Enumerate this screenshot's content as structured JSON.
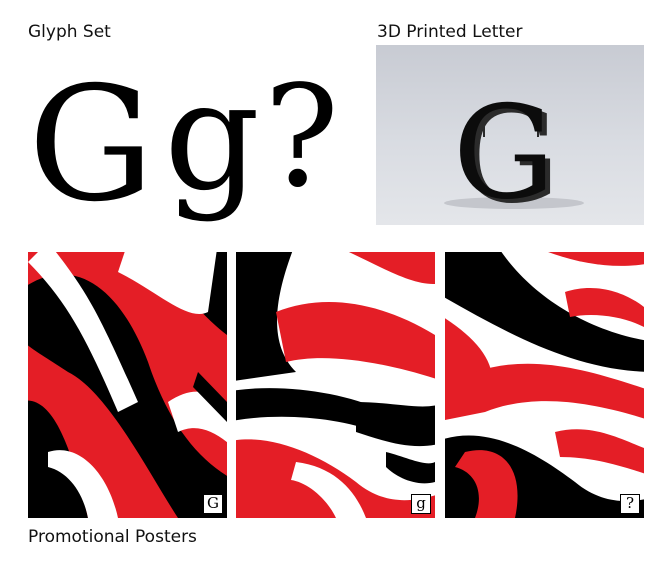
{
  "sections": {
    "glyph_set": {
      "title": "Glyph Set",
      "glyphs": [
        "G",
        "g",
        "?"
      ]
    },
    "printed": {
      "title": "3D Printed Letter",
      "letter": "G"
    },
    "posters": {
      "title": "Promotional Posters",
      "items": [
        {
          "badge": "G"
        },
        {
          "badge": "g"
        },
        {
          "badge": "?"
        }
      ]
    }
  },
  "colors": {
    "red": "#e41e26",
    "black": "#000000",
    "white": "#ffffff"
  }
}
